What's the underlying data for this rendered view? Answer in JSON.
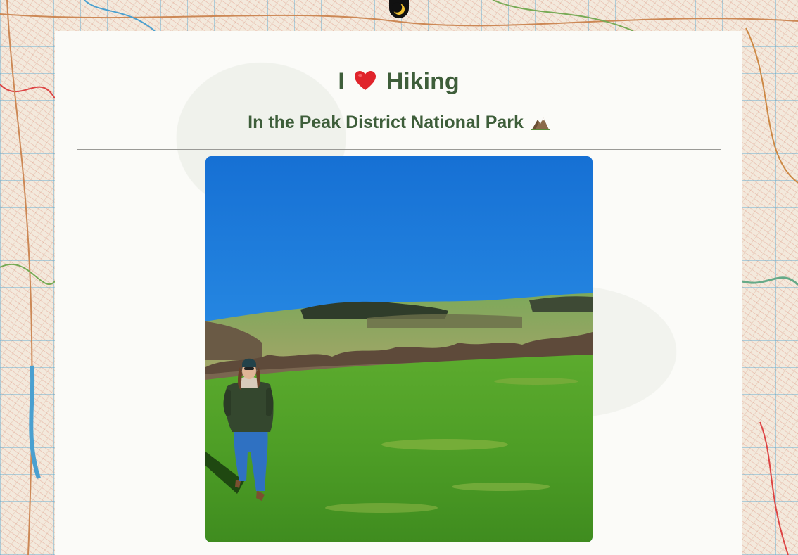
{
  "header": {
    "title_before": "I",
    "title_after": "Hiking",
    "subtitle": "In the Peak District National Park"
  },
  "icons": {
    "theme_toggle": "crescent-moon-icon",
    "title": "red-heart-icon",
    "subtitle": "snow-capped-mountain-icon"
  },
  "photo": {
    "description_icon": "hiker-in-field-photo"
  },
  "colors": {
    "heading": "#3e5e3a",
    "card_background": "#fbfbf8",
    "divider": "#9a9a96",
    "toggle_background": "#111111",
    "moon": "#f2c230",
    "heart": "#e0242b"
  }
}
